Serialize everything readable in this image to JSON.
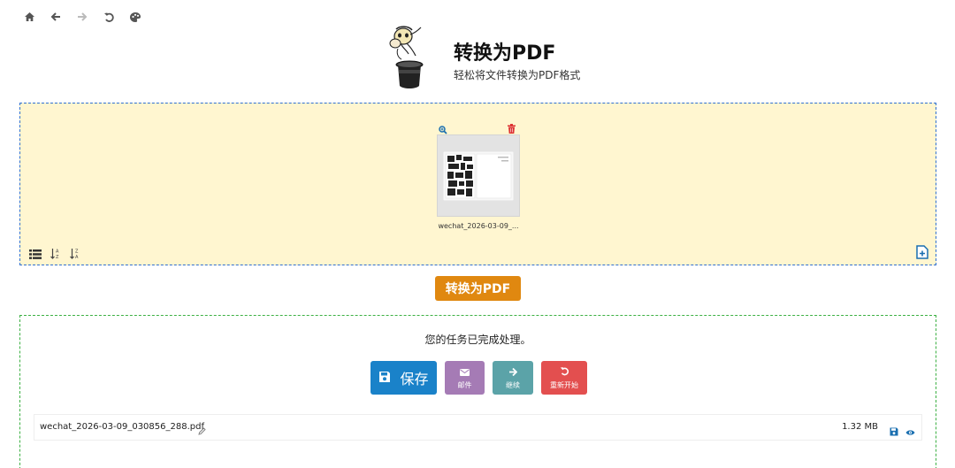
{
  "nav": {
    "icons": [
      "home-icon",
      "back-arrow-icon",
      "forward-arrow-icon",
      "undo-icon",
      "theme-palette-icon"
    ]
  },
  "header": {
    "title": "转换为PDF",
    "subtitle": "轻松将文件转换为PDF格式"
  },
  "dropzone": {
    "file": {
      "name": "wechat_2026-03-09_..."
    },
    "tools": [
      "list-view-icon",
      "sort-az-icon",
      "sort-za-icon"
    ],
    "add_icon": "add-file-icon"
  },
  "convert": {
    "label": "转换为PDF"
  },
  "result": {
    "message": "您的任务已完成处理。",
    "actions": {
      "save": "保存",
      "mail": "邮件",
      "continue": "继续",
      "restart": "重新开始"
    },
    "file": {
      "name": "wechat_2026-03-09_030856_288.pdf",
      "size": "1.32 MB"
    }
  },
  "colors": {
    "dropzone_bg": "#fff6d0",
    "dropzone_border": "#2f6fd0",
    "convert": "#e08810",
    "save": "#1a82c9",
    "mail": "#a57bb5",
    "continue": "#5ba3a8",
    "restart": "#e34f4f",
    "result_border": "#3cb043"
  }
}
